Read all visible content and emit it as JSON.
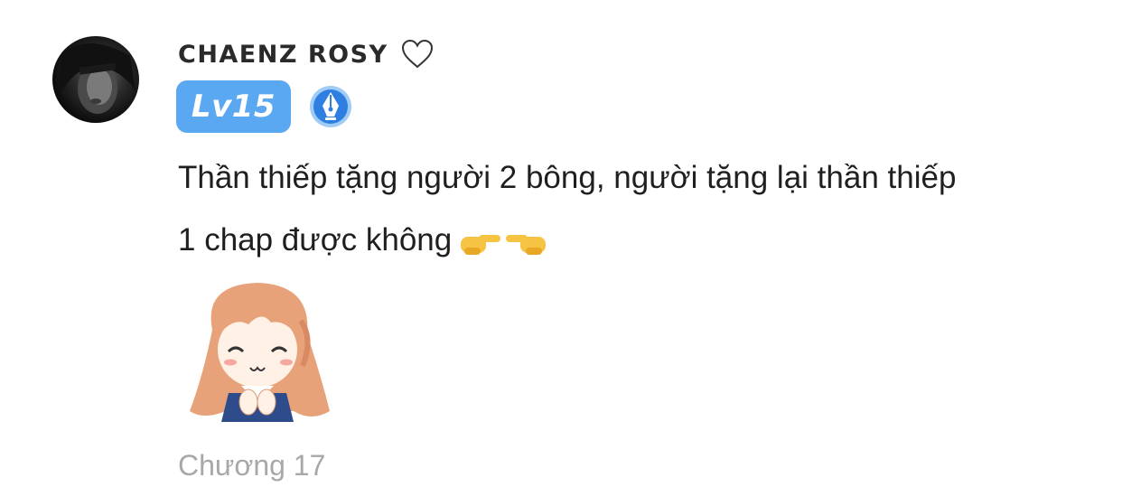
{
  "comment": {
    "username": "CHAENZ ROSY",
    "level_badge": "Lv15",
    "text_lines": [
      "Thần thiếp tặng người 2 bông, người tặng lại thần thiếp",
      "1 chap được không"
    ],
    "chapter": "Chương 17"
  },
  "icons": {
    "heart": "heart-outline-icon",
    "author_badge": "pen-nib-icon",
    "emoji": "pointing-hands-emoji-icon",
    "sticker": "anime-girl-sticker"
  },
  "colors": {
    "level_badge_bg": "#5aa8f2",
    "chapter_text": "#a8a8a8",
    "pen_badge_bg": "#2f7fe0"
  }
}
